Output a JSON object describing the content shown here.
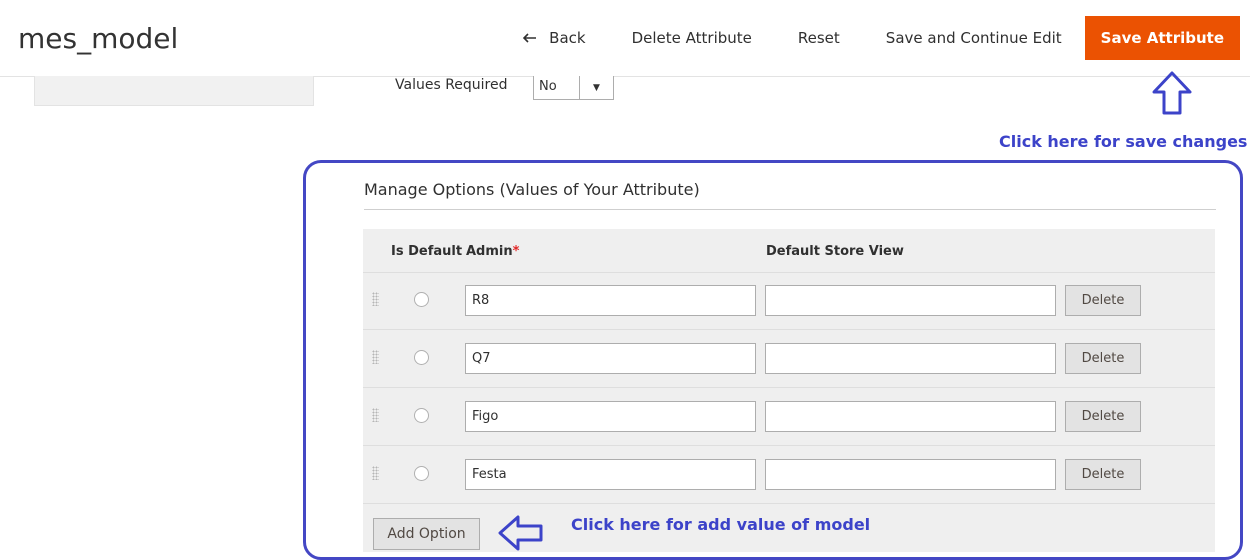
{
  "page": {
    "title": "mes_model"
  },
  "toolbar": {
    "back_label": "Back",
    "delete_label": "Delete Attribute",
    "reset_label": "Reset",
    "save_continue_label": "Save and Continue Edit",
    "save_label": "Save Attribute",
    "primary_color": "#eb5202"
  },
  "properties": {
    "values_required_label": "Values Required",
    "values_required_value": "No"
  },
  "annotations": {
    "save_hint": "Click here for save changes",
    "add_hint": "Click here for add value of model",
    "color": "#3c43c9"
  },
  "options": {
    "section_title": "Manage Options (Values of Your Attribute)",
    "headers": {
      "is_default": "Is Default",
      "admin": "Admin",
      "required_mark": "*",
      "default_store_view": "Default Store View"
    },
    "rows": [
      {
        "admin": "R8",
        "store_view": "",
        "delete_label": "Delete"
      },
      {
        "admin": "Q7",
        "store_view": "",
        "delete_label": "Delete"
      },
      {
        "admin": "Figo",
        "store_view": "",
        "delete_label": "Delete"
      },
      {
        "admin": "Festa",
        "store_view": "",
        "delete_label": "Delete"
      }
    ],
    "add_option_label": "Add Option"
  }
}
